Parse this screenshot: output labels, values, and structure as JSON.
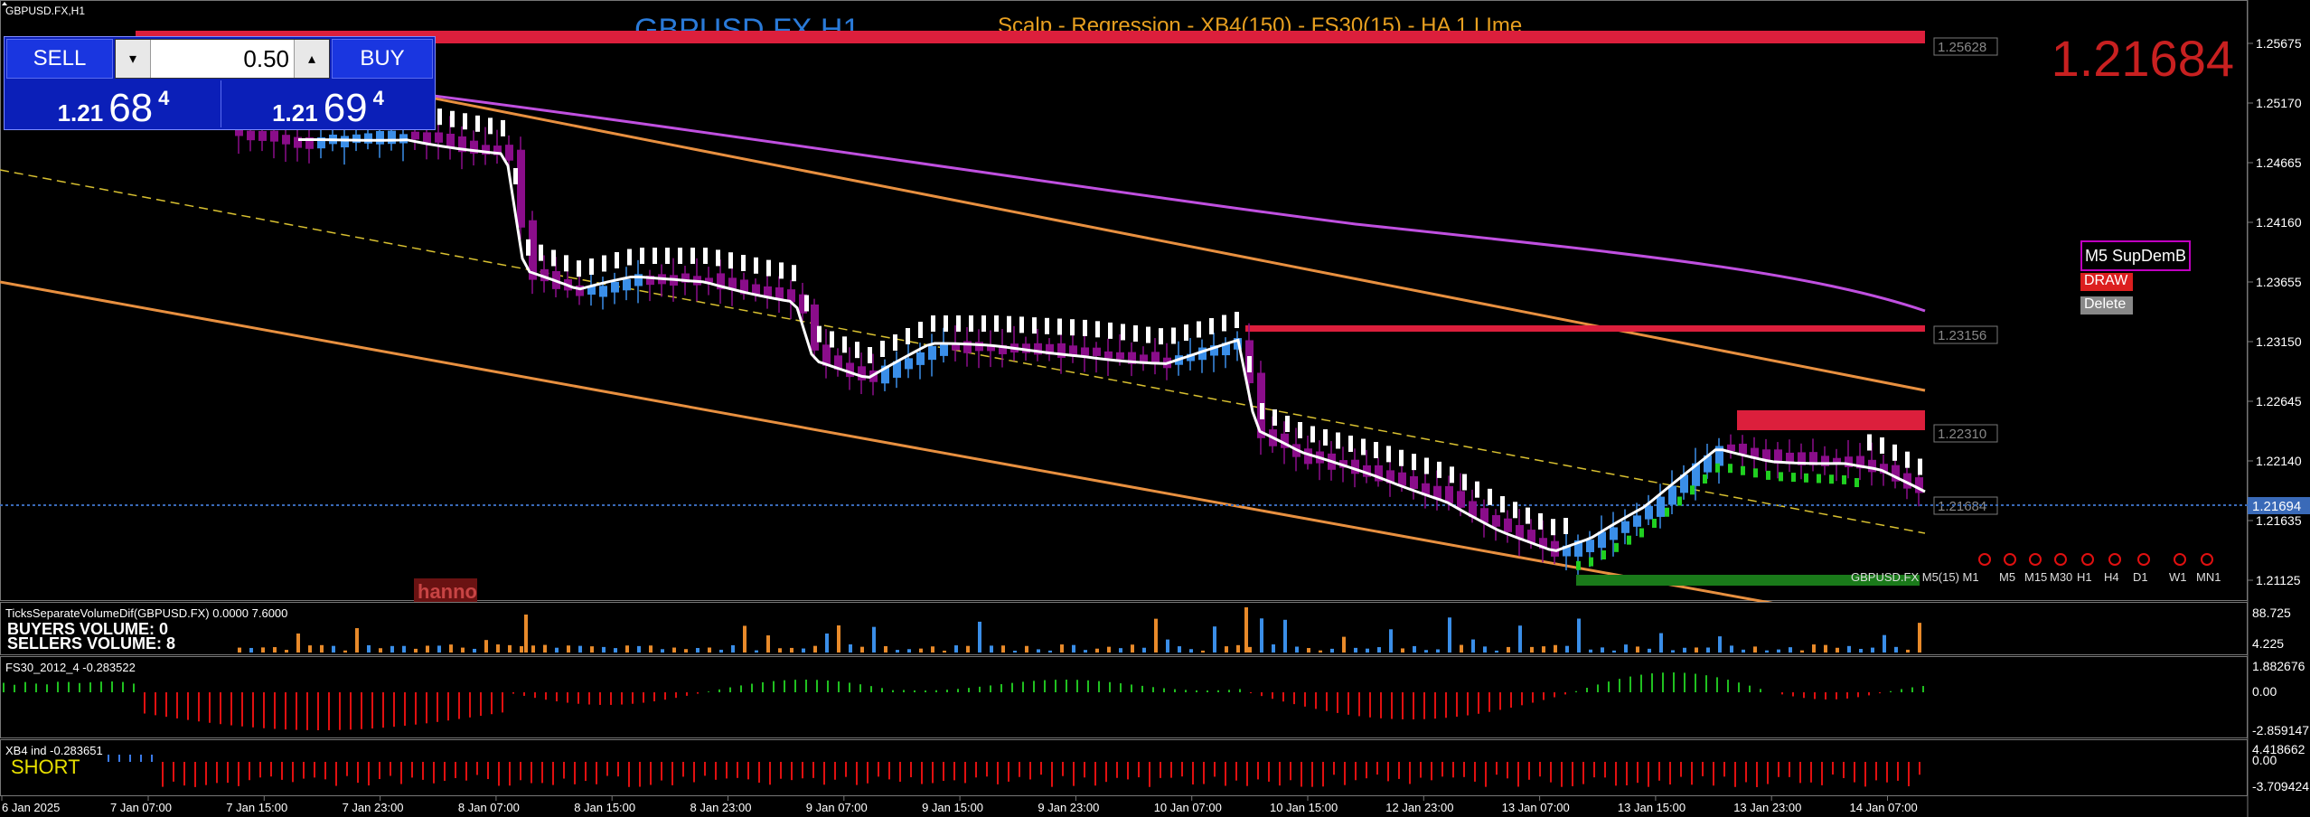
{
  "window": {
    "symbol_tag": "GBPUSD.FX,H1"
  },
  "chart": {
    "title": "GBPUSD.FX H1",
    "indicator_title": "Scalp - Regression - XB4(150) - FS30(15) - HA  1 LIme",
    "big_price": "1.21684",
    "price_axis": [
      "1.25675",
      "1.25170",
      "1.24665",
      "1.24160",
      "1.23655",
      "1.23150",
      "1.22645",
      "1.22140",
      "1.21635",
      "1.21125"
    ],
    "current_price_tag": "1.21694",
    "level_labels": [
      "1.25628",
      "1.23156",
      "1.22310",
      "1.21684"
    ],
    "time_axis": [
      "6 Jan 2025",
      "7 Jan 07:00",
      "7 Jan 15:00",
      "7 Jan 23:00",
      "8 Jan 07:00",
      "8 Jan 15:00",
      "8 Jan 23:00",
      "9 Jan 07:00",
      "9 Jan 15:00",
      "9 Jan 23:00",
      "10 Jan 07:00",
      "10 Jan 15:00",
      "12 Jan 23:00",
      "13 Jan 07:00",
      "13 Jan 15:00",
      "13 Jan 23:00",
      "14 Jan 07:00"
    ],
    "watermark": "hanno",
    "timeframe_label": "GBPUSD.FX M5(15)  M1",
    "timeframes": [
      "M5",
      "M15",
      "M30",
      "H1",
      "H4",
      "D1",
      "W1",
      "MN1"
    ]
  },
  "trade_panel": {
    "sell_label": "SELL",
    "buy_label": "BUY",
    "lot": "0.50",
    "down_arrow": "▾",
    "up_arrow": "▴",
    "sell_price": {
      "prefix": "1.21",
      "big": "68",
      "sup": "4"
    },
    "buy_price": {
      "prefix": "1.21",
      "big": "69",
      "sup": "4"
    }
  },
  "sd_widget": {
    "title": "M5 SupDemB",
    "draw": "DRAW",
    "delete": "Delete"
  },
  "volume_panel": {
    "header": "TicksSeparateVolumeDif(GBPUSD.FX) 0.0000 7.6000",
    "buyers": "BUYERS VOLUME: 0",
    "sellers": "SELLERS VOLUME: 8",
    "axis": [
      "88.725",
      "4.225"
    ]
  },
  "fs30_panel": {
    "header": "FS30_2012_4 -0.283522",
    "axis": [
      "1.882676",
      "0.00",
      "-2.859147"
    ]
  },
  "xb4_panel": {
    "header": "XB4 ind -0.283651",
    "signal": "SHORT",
    "axis": [
      "4.418662",
      "0.00",
      "-3.709424"
    ]
  },
  "colors": {
    "background": "#000000",
    "bull_candle": "#3a8ee8",
    "bear_candle": "#8a0d8a",
    "regression_upper": "#e89040",
    "regression_mid": "#d8c030",
    "magenta_line": "#c050e0",
    "supply_zone": "#dc1f3c",
    "demand_zone": "#1a7a1a",
    "title_blue": "#2a7ad8",
    "indicator_title_color": "#e8a020",
    "big_price_color": "#c82020",
    "fs30_pos": "#20c020",
    "fs30_neg": "#e01010",
    "xb4_pos": "#3a7ae8",
    "xb4_neg": "#e01010"
  }
}
